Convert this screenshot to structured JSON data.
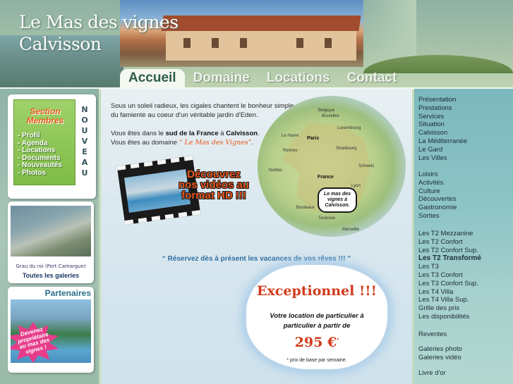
{
  "site": {
    "title_line1": "Le Mas des vignes",
    "title_line2": "Calvisson"
  },
  "nav": {
    "tabs": [
      {
        "label": "Accueil",
        "active": true
      },
      {
        "label": "Domaine",
        "active": false
      },
      {
        "label": "Locations",
        "active": false
      },
      {
        "label": "Contact",
        "active": false
      }
    ]
  },
  "members": {
    "title_line1": "Section",
    "title_line2": "Membres",
    "items": [
      "- Profil",
      "- Agenda",
      "- Locations",
      "- Documents",
      "- Nouveautés",
      "- Photos"
    ],
    "badge_letters": [
      "N",
      "O",
      "U",
      "V",
      "E",
      "A",
      "U"
    ]
  },
  "gallery": {
    "caption": "Grau du roi (Port Camargue)",
    "link": "Toutes les galeries"
  },
  "partners": {
    "title": "Partenaires",
    "promo_line1": "Devenez",
    "promo_line2": "propriétaire",
    "promo_line3": "au mas des",
    "promo_line4": "vignes !"
  },
  "intro": {
    "p1": "Sous un soleil radieux, les cigales chantent le bonheur simple du famiente au coeur d'un véritable jardin d'Eden.",
    "p2_pre": "Vous êtes dans le ",
    "p2_b1": "sud de la France",
    "p2_mid": " à ",
    "p2_b2": "Calvisson",
    "p2_post": ".",
    "p3_pre": "Vous êtes au domaine ",
    "p3_hl": "“ Le Mas des Vignes”",
    "p3_post": "."
  },
  "map": {
    "cities": [
      {
        "name": "Belgique",
        "big": false
      },
      {
        "name": "Bruxelles",
        "big": false
      },
      {
        "name": "Le Havre",
        "big": false
      },
      {
        "name": "Paris",
        "big": true
      },
      {
        "name": "Luxembourg",
        "big": false
      },
      {
        "name": "Rennes",
        "big": false
      },
      {
        "name": "Strasbourg",
        "big": false
      },
      {
        "name": "Nantes",
        "big": false
      },
      {
        "name": "France",
        "big": true
      },
      {
        "name": "Schweiz",
        "big": false
      },
      {
        "name": "Lyon",
        "big": false
      },
      {
        "name": "Bordeaux",
        "big": false
      },
      {
        "name": "Toulouse",
        "big": false
      },
      {
        "name": "Marseille",
        "big": false
      }
    ],
    "bubble": "Le mas des vignes à Calvisson."
  },
  "promo": {
    "line1": "Découvrez",
    "line2": "nos vidéos au",
    "line3": "format HD !!!"
  },
  "reserve": "“ Réservez dès à présent les vacances de vos rêves !!! ”",
  "offer": {
    "title": "Exceptionnel !!!",
    "text_line1": "Votre location de particulier à",
    "text_line2": "particulier à partir de",
    "price": "295 €",
    "price_mark": "*",
    "note": "* prix de base par semaine."
  },
  "right_menu": {
    "group1": [
      "Présentation",
      "Prestations",
      "Services",
      "Situation",
      "Calvisson",
      "La Méditerranée",
      "Le Gard",
      "Les Villes"
    ],
    "group2": [
      "Loisirs",
      "Activités",
      "Culture",
      "Découvertes",
      "Gastronomie",
      "Sorties"
    ],
    "group3": [
      "Les T2 Mezzanine",
      "Les T2 Confort",
      "Les T2 Confort Sup.",
      "Les T2 Transformé",
      "Les T3",
      "Les T3 Confort",
      "Les T3 Confort Sup.",
      "Les T4 Villa",
      "Les T4 Villa Sup.",
      "Grille des prix",
      "Les disponibilités"
    ],
    "group4": [
      "Reventes"
    ],
    "group5": [
      "Galeries photo",
      "Galeries vidéo"
    ],
    "group6": [
      "Livre d'or"
    ]
  }
}
